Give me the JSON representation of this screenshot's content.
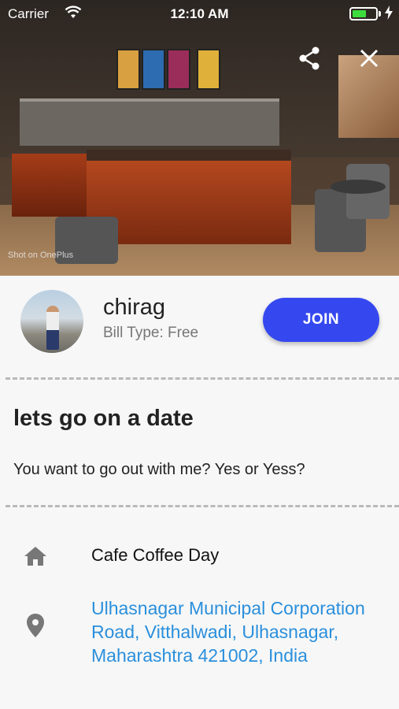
{
  "status_bar": {
    "carrier": "Carrier",
    "time": "12:10 AM",
    "battery_level": 0.6
  },
  "hero": {
    "share_icon": "share-icon",
    "close_icon": "close-icon",
    "watermark": "Shot on OnePlus"
  },
  "host": {
    "name": "chirag",
    "bill_type": "Bill Type: Free",
    "join_label": "JOIN"
  },
  "event": {
    "title": "lets go on a date",
    "description": "You want to go out with me? Yes or Yess?"
  },
  "location": {
    "venue_icon": "home-icon",
    "venue": "Cafe Coffee Day",
    "address_icon": "location-pin-icon",
    "address": "Ulhasnagar Municipal Corporation Road, Vitthalwadi, Ulhasnagar, Maharashtra 421002, India"
  },
  "colors": {
    "accent": "#3548f0",
    "link": "#2a8fdc",
    "icon_gray": "#777777"
  }
}
